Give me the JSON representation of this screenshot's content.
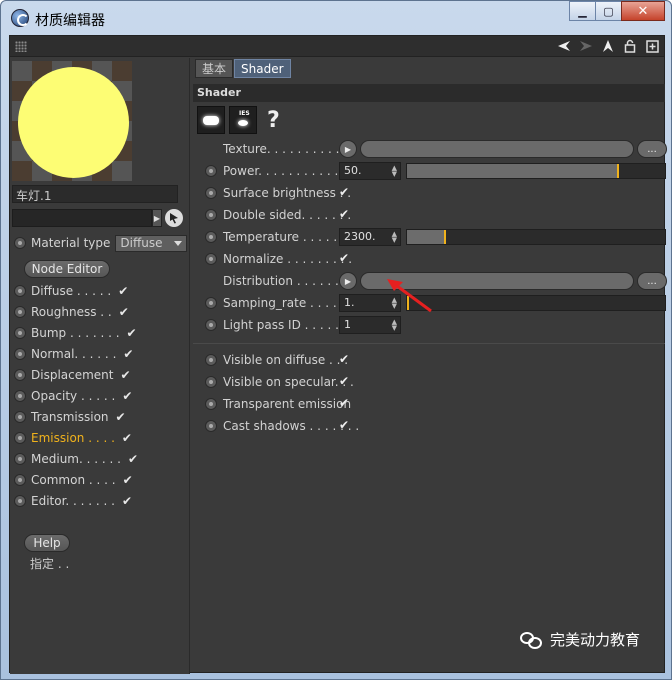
{
  "window": {
    "title": "材质编辑器"
  },
  "material": {
    "name": "车灯.1",
    "type_label": "Material type",
    "type_value": "Diffuse",
    "preview_color": "#fdfd74"
  },
  "buttons": {
    "node_editor": "Node Editor",
    "help": "Help"
  },
  "channels": [
    {
      "label": "Diffuse . . . . .",
      "checked": true,
      "active": false
    },
    {
      "label": "Roughness . .",
      "checked": true,
      "active": false
    },
    {
      "label": "Bump . . . . . . .",
      "checked": true,
      "active": false
    },
    {
      "label": "Normal. . . . . .",
      "checked": true,
      "active": false
    },
    {
      "label": "Displacement",
      "checked": true,
      "active": false
    },
    {
      "label": "Opacity . . . . .",
      "checked": true,
      "active": false
    },
    {
      "label": "Transmission",
      "checked": true,
      "active": false
    },
    {
      "label": "Emission . . . .",
      "checked": true,
      "active": true
    },
    {
      "label": "Medium. . . . . .",
      "checked": true,
      "active": false
    },
    {
      "label": "Common . . . .",
      "checked": true,
      "active": false
    },
    {
      "label": "Editor. . . . . . .",
      "checked": true,
      "active": false
    }
  ],
  "assign_label": "指定 . .",
  "tabs": [
    {
      "label": "基本",
      "active": false
    },
    {
      "label": "Shader",
      "active": true
    }
  ],
  "section": {
    "title": "Shader"
  },
  "params": {
    "texture": "Texture. . . . . . . . . . . .",
    "power": {
      "label": "Power. . . . . . . . . . . . .",
      "value": "50.",
      "level": 0.82
    },
    "surface_brightness": "Surface brightness . .",
    "double_sided": "Double sided. . . . . . .",
    "temperature": {
      "label": "Temperature . . . . . . .",
      "value": "2300.",
      "level": 0.15
    },
    "normalize": "Normalize . . . . . . . . .",
    "distribution": "Distribution . . . . . . . .",
    "samping_rate": {
      "label": "Samping_rate . . . . . .",
      "value": "1.",
      "level": 0.0
    },
    "light_pass_id": {
      "label": "Light pass ID . . . . . . .",
      "value": "1"
    },
    "visible_diffuse": "Visible on diffuse . . .",
    "visible_specular": "Visible on specular. . .",
    "transparent_emission": "Transparent emission",
    "cast_shadows": "Cast shadows . . . . . . ."
  },
  "icons": {
    "app": "cinema4d-icon",
    "grip": "grip-icon",
    "pick": "pick-cursor-icon",
    "toolbar": [
      "back-arrow-icon",
      "forward-arrow-icon",
      "up-arrow-icon",
      "lock-icon",
      "new-window-icon"
    ],
    "shader": [
      "area-light-icon",
      "ies-light-icon",
      "help-question-icon"
    ]
  },
  "glyphs": {
    "check": "✔",
    "minimize": "▁",
    "maximize": "▢",
    "close": "✕",
    "dots": "...",
    "spin": "▴▾",
    "link_arrow": "▶"
  },
  "watermark": {
    "text": "完美动力教育"
  },
  "colors": {
    "accent_tab": "#4f6179",
    "slider_marker": "#f0b21c",
    "active_channel": "#f0b21c",
    "annotation_arrow": "#e62020"
  }
}
